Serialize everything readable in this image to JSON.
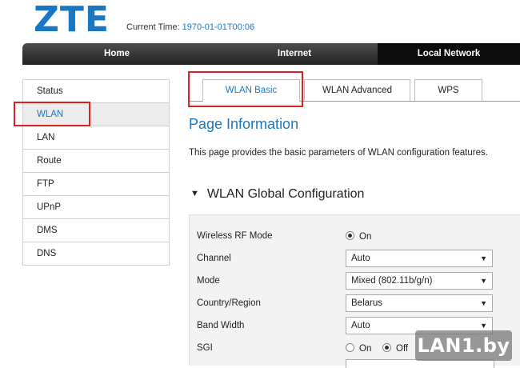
{
  "brand": {
    "logo": "ZTE"
  },
  "header": {
    "time_label": "Current Time:",
    "time_value": "1970-01-01T00:06"
  },
  "nav": {
    "home": "Home",
    "internet": "Internet",
    "local_network": "Local Network"
  },
  "sidebar": {
    "items": [
      {
        "label": "Status"
      },
      {
        "label": "WLAN"
      },
      {
        "label": "LAN"
      },
      {
        "label": "Route"
      },
      {
        "label": "FTP"
      },
      {
        "label": "UPnP"
      },
      {
        "label": "DMS"
      },
      {
        "label": "DNS"
      }
    ],
    "active": "WLAN"
  },
  "tabs": [
    {
      "label": "WLAN Basic"
    },
    {
      "label": "WLAN Advanced"
    },
    {
      "label": "WPS"
    }
  ],
  "main": {
    "page_title": "Page Information",
    "description": "This page provides the basic parameters of WLAN configuration features.",
    "section_title": "WLAN Global Configuration",
    "fields": {
      "rf_mode": {
        "label": "Wireless RF Mode",
        "option_on": "On"
      },
      "channel": {
        "label": "Channel",
        "value": "Auto"
      },
      "mode": {
        "label": "Mode",
        "value": "Mixed (802.11b/g/n)"
      },
      "country": {
        "label": "Country/Region",
        "value": "Belarus"
      },
      "bandwidth": {
        "label": "Band Width",
        "value": "Auto"
      },
      "sgi": {
        "label": "SGI",
        "option_on": "On",
        "option_off": "Off"
      }
    }
  },
  "watermark": "LAN1.by",
  "colors": {
    "accent": "#1a78c2",
    "highlight": "#e02020",
    "nav_bg": "#222222"
  }
}
